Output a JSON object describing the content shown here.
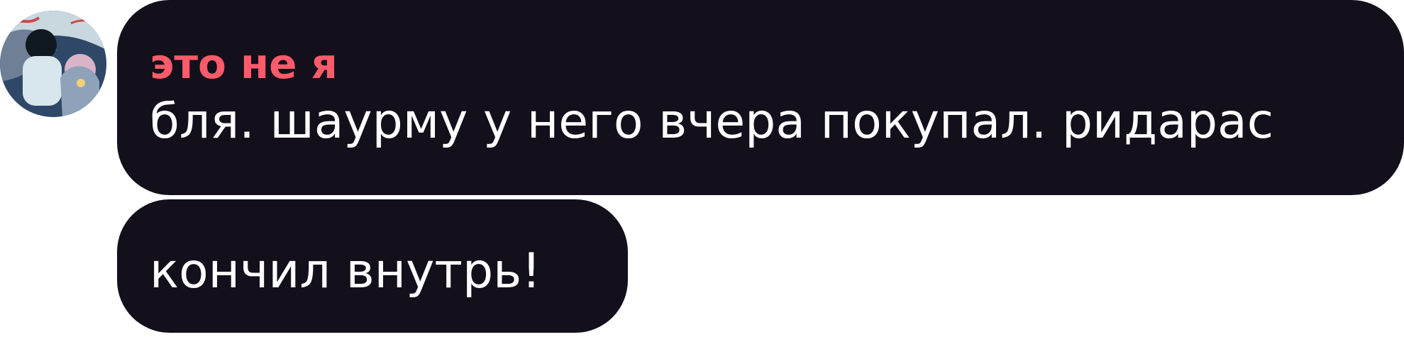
{
  "chat": {
    "avatar_icon": "user-avatar",
    "messages": [
      {
        "sender": "это не я",
        "text": "бля. шаурму у него вчера покупал. ридарас"
      },
      {
        "text": "кончил внутрь!"
      }
    ],
    "colors": {
      "bubble_background": "#13101c",
      "sender_name": "#ff5b6a",
      "message_text": "#ffffff",
      "page_background": "#ffffff"
    }
  }
}
